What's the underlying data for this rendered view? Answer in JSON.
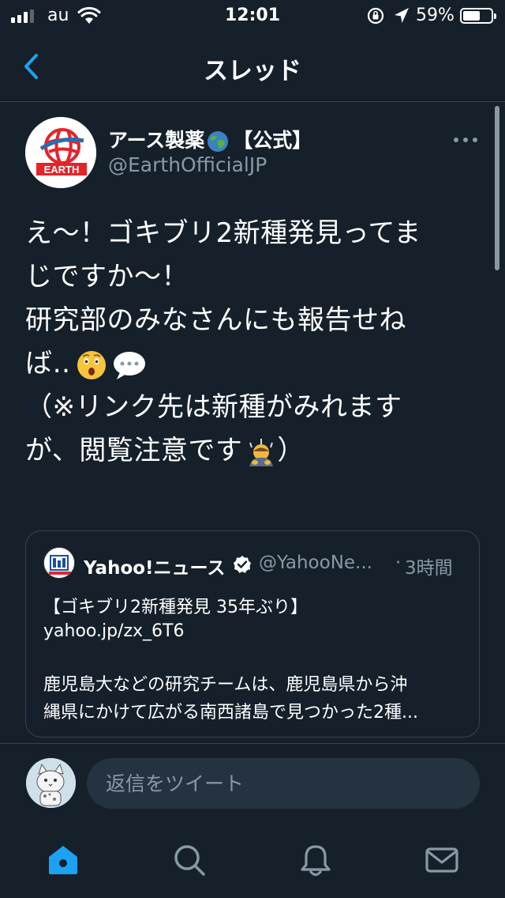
{
  "status_bar": {
    "carrier": "au",
    "time": "12:01",
    "battery_percent": "59%",
    "battery_level": 0.59,
    "icons": [
      "signal-icon",
      "wifi-icon",
      "orientation-lock-icon",
      "location-arrow-icon",
      "battery-icon"
    ]
  },
  "nav": {
    "title": "スレッド",
    "back_icon": "chevron-left-icon"
  },
  "tweet": {
    "author_name": "アース製薬",
    "author_badge": "【公式】",
    "author_handle": "@EarthOfficialJP",
    "avatar_logo_text": "EARTH",
    "lines": [
      "え〜！ゴキブリ2新種発見ってま",
      "じですか〜！",
      "研究部のみなさんにも報告せね",
      "ば‥",
      "（※リンク先は新種がみれます",
      "が、閲覧注意です"
    ],
    "line6_end": "）",
    "emojis": [
      "globe-emoji",
      "astonished-face-emoji",
      "speech-balloon-emoji",
      "bowing-person-emoji"
    ]
  },
  "quote": {
    "name": "Yahoo!ニュース",
    "handle": "@YahooNe...",
    "dot": "·",
    "time": "3時間",
    "title": "【ゴキブリ2新種発見 35年ぶり】",
    "link": "yahoo.jp/zx_6T6",
    "body_line1": "鹿児島大などの研究チームは、鹿児島県から沖",
    "body_line2": "縄県にかけて広がる南西諸島で見つかった2種..."
  },
  "reply": {
    "placeholder": "返信をツイート"
  },
  "tab_bar": {
    "tabs": [
      "home-icon",
      "search-icon",
      "notifications-icon",
      "messages-icon"
    ],
    "active_color": "#1da1f2"
  },
  "colors": {
    "background": "#15202b",
    "secondary_text": "#8899a6",
    "accent": "#1da1f2",
    "border": "#38444d"
  }
}
